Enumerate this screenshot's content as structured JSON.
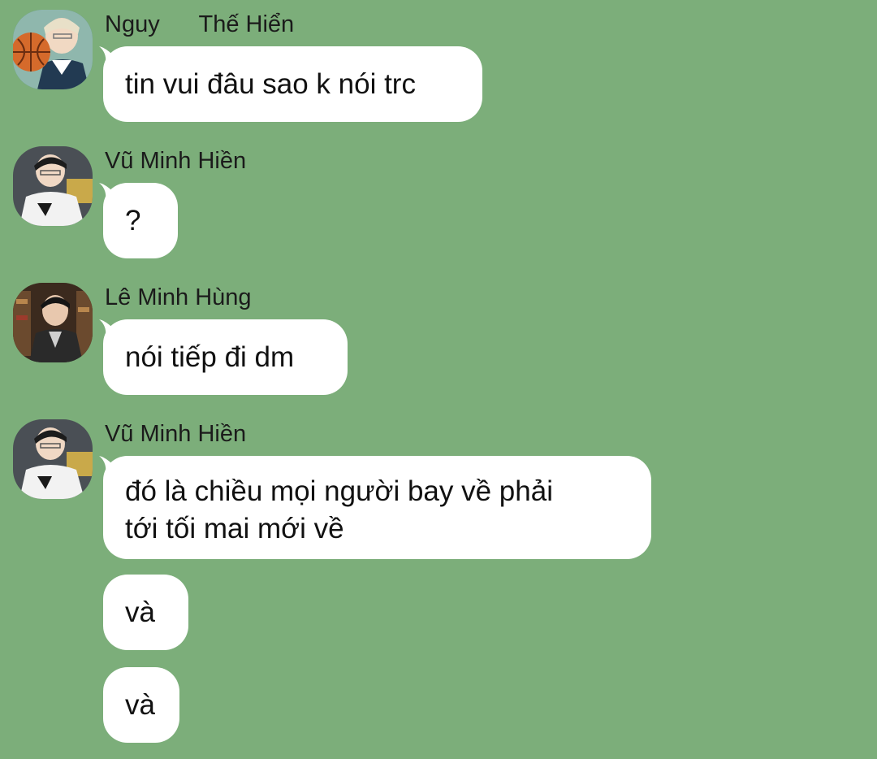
{
  "messages": [
    {
      "sender": "Nguy      Thế Hiển",
      "avatar": "avatar-basketball-player",
      "bubbles": [
        "tin vui đâu sao k nói trc"
      ]
    },
    {
      "sender": "Vũ Minh Hiền",
      "avatar": "avatar-esports-player",
      "bubbles": [
        "?"
      ]
    },
    {
      "sender": "Lê Minh Hùng",
      "avatar": "avatar-man-in-bookstore",
      "bubbles": [
        "nói tiếp đi dm"
      ]
    },
    {
      "sender": "Vũ Minh Hiền",
      "avatar": "avatar-esports-player",
      "bubbles": [
        "đó là chiều mọi người bay về phải",
        "tới tối mai mới về"
      ],
      "followups": [
        "và",
        "và"
      ]
    }
  ],
  "colors": {
    "background": "#7cae7a",
    "bubble": "#ffffff",
    "text": "#111111"
  }
}
